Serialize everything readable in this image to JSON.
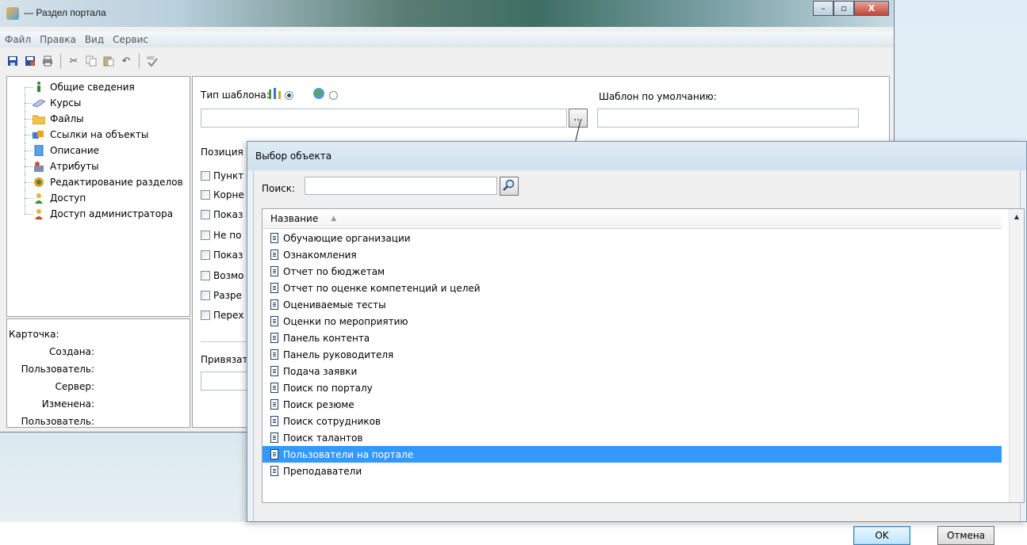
{
  "window": {
    "title": "— Раздел портала",
    "controls": {
      "minimize": "–",
      "maximize": "▫",
      "close": "X"
    }
  },
  "menu": [
    "Файл",
    "Правка",
    "Вид",
    "Сервис"
  ],
  "toolbar": {
    "icons": [
      "save-icon",
      "save-as-icon",
      "print-icon",
      "cut-icon",
      "copy-icon",
      "paste-icon",
      "undo-icon",
      "spellcheck-icon"
    ]
  },
  "sidebar": {
    "items": [
      {
        "label": "Общие сведения",
        "icon": "info-icon"
      },
      {
        "label": "Курсы",
        "icon": "course-icon"
      },
      {
        "label": "Файлы",
        "icon": "folder-icon"
      },
      {
        "label": "Ссылки на объекты",
        "icon": "links-icon"
      },
      {
        "label": "Описание",
        "icon": "description-icon"
      },
      {
        "label": "Атрибуты",
        "icon": "attributes-icon"
      },
      {
        "label": "Редактирование разделов",
        "icon": "edit-sections-icon"
      },
      {
        "label": "Доступ",
        "icon": "access-icon"
      },
      {
        "label": "Доступ администратора",
        "icon": "admin-access-icon"
      }
    ]
  },
  "card": {
    "title": "Карточка:",
    "created": "Создана:",
    "created_user": "Пользователь:",
    "server": "Сервер:",
    "modified": "Изменена:",
    "modified_user": "Пользователь:"
  },
  "form": {
    "template_type_label": "Тип шаблона:",
    "default_template_label": "Шаблон по умолчанию:",
    "browse_label": "...",
    "position_label": "Позиция",
    "checkboxes": [
      "Пункт",
      "Корне",
      "Показ",
      "Не по",
      "Показ",
      "Возмо",
      "Разре",
      "Перех"
    ],
    "bind_label": "Привязат"
  },
  "dialog": {
    "title": "Выбор объекта",
    "search_label": "Поиск:",
    "search_value": "",
    "column_header": "Название",
    "items": [
      "Обучающие организации",
      "Ознакомления",
      "Отчет по бюджетам",
      "Отчет по оценке компетенций и целей",
      "Оцениваемые тесты",
      "Оценки по мероприятию",
      "Панель контента",
      "Панель руководителя",
      "Подача заявки",
      "Поиск по порталу",
      "Поиск резюме",
      "Поиск сотрудников",
      "Поиск талантов",
      "Пользователи на портале",
      "Преподаватели"
    ],
    "selected_index": 13,
    "ok_label": "OK",
    "cancel_label": "Отмена"
  },
  "colors": {
    "selection": "#3399ff"
  }
}
